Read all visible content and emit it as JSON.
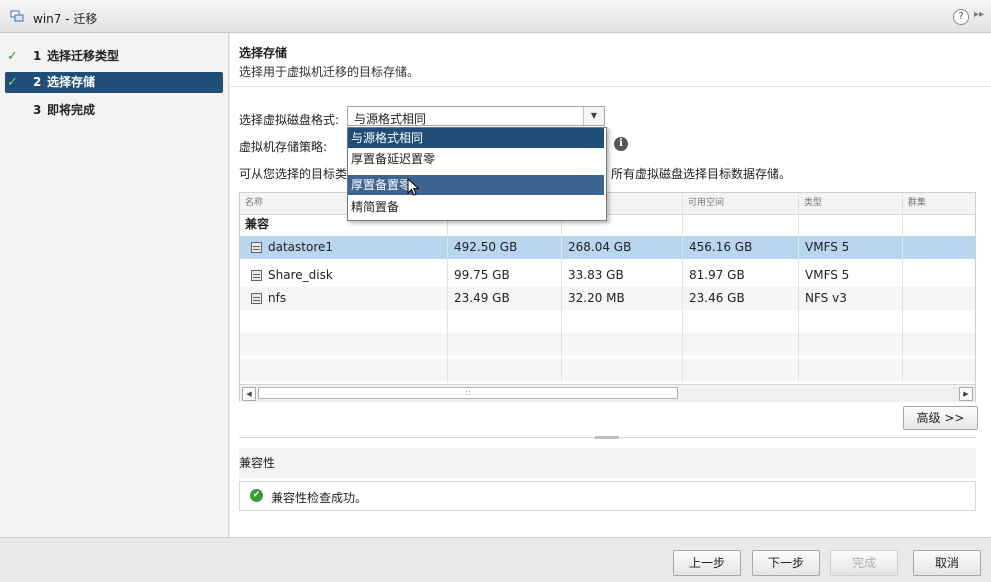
{
  "window": {
    "title": "win7 - 迁移",
    "help_label": "?",
    "expand_label": "▸▸"
  },
  "sidebar": {
    "steps": [
      {
        "num": "1",
        "label": "选择迁移类型",
        "done": true
      },
      {
        "num": "2",
        "label": "选择存储",
        "done": true,
        "active": true
      },
      {
        "num": "3",
        "label": "即将完成",
        "done": false
      }
    ],
    "check_glyph": "✓"
  },
  "main": {
    "heading": "选择存储",
    "subheading": "选择用于虚拟机迁移的目标存储。",
    "disk_format_label": "选择虚拟磁盘格式:",
    "disk_format_value": "与源格式相同",
    "policy_label": "虚拟机存储策略:",
    "desc_a": "可从您选择的目标类",
    "desc_b": "所有虚拟磁盘选择目标数据存储。",
    "dropdown_options": [
      "与源格式相同",
      "厚置备延迟置零",
      "厚置备置零",
      "精简置备"
    ],
    "info_glyph": "i"
  },
  "table": {
    "columns": [
      "名称",
      "",
      "",
      "可用空间",
      "类型",
      "群集"
    ],
    "group": "兼容",
    "rows": [
      {
        "name": "datastore1",
        "capacity": "492.50 GB",
        "provisioned": "268.04 GB",
        "free": "456.16 GB",
        "type": "VMFS 5"
      },
      {
        "name": "Share_disk",
        "capacity": "99.75 GB",
        "provisioned": "33.83 GB",
        "free": "81.97 GB",
        "type": "VMFS 5"
      },
      {
        "name": "nfs",
        "capacity": "23.49 GB",
        "provisioned": "32.20 MB",
        "free": "23.46 GB",
        "type": "NFS v3"
      }
    ],
    "scroll_left": "◀",
    "scroll_right": "▶",
    "scroll_grip": "::"
  },
  "advanced_button": "高级 >>",
  "compat": {
    "title": "兼容性",
    "message": "兼容性检查成功。",
    "ok_glyph": "✔"
  },
  "footer": {
    "back": "上一步",
    "next": "下一步",
    "finish": "完成",
    "cancel": "取消"
  },
  "colors": {
    "accent": "#1f4e79",
    "selected_row": "#b9d5f0",
    "ok": "#3a9a3a"
  }
}
